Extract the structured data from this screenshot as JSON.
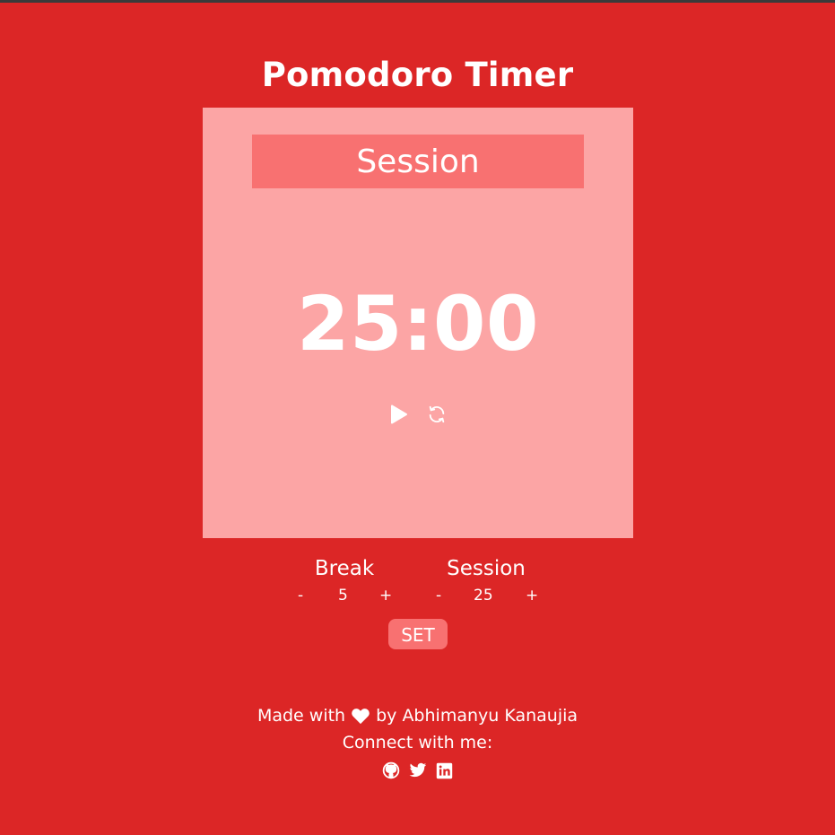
{
  "header": {
    "title": "Pomodoro Timer"
  },
  "timer": {
    "mode_label": "Session",
    "time": "25:00",
    "play_icon": "play-icon",
    "reset_icon": "refresh-icon"
  },
  "settings": {
    "break": {
      "label": "Break",
      "minus": "-",
      "value": "5",
      "plus": "+"
    },
    "session": {
      "label": "Session",
      "minus": "-",
      "value": "25",
      "plus": "+"
    },
    "set_label": "SET"
  },
  "footer": {
    "made_with": "Made with",
    "heart_icon": "heart-icon",
    "by_author": "by Abhimanyu Kanaujia",
    "connect": "Connect with me:",
    "social": [
      "github-icon",
      "twitter-icon",
      "linkedin-icon"
    ]
  },
  "colors": {
    "background": "#dc2626",
    "card": "#fca5a5",
    "accent": "#f87171",
    "text": "#ffffff"
  }
}
